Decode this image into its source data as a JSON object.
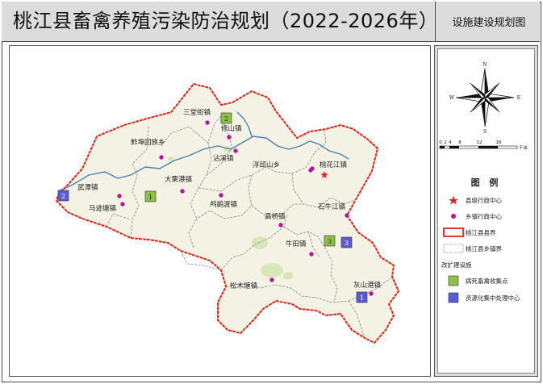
{
  "header": {
    "title": "桃江县畜禽养殖污染防治规划（2022-2026年）",
    "subtitle": "设施建设规划图"
  },
  "colors": {
    "county_border": "#e0261c",
    "township_border": "#8a8a8a",
    "land": "#f3f2e4",
    "forest": "#d8e7b8",
    "river": "#4a7fb5",
    "town_marker": "#b5169d",
    "county_center": "#e0261c",
    "collection_point": "#8fbe49",
    "resource_center": "#5b5bd6"
  },
  "map": {
    "towns": [
      {
        "name": "三堂街镇"
      },
      {
        "name": "修山镇"
      },
      {
        "name": "鲊埠回族乡"
      },
      {
        "name": "武潭镇"
      },
      {
        "name": "沾溪镇"
      },
      {
        "name": "浮邱山乡"
      },
      {
        "name": "桃花江镇"
      },
      {
        "name": "大栗港镇"
      },
      {
        "name": "马迹塘镇"
      },
      {
        "name": "鸬鹚渡镇"
      },
      {
        "name": "石牛江镇"
      },
      {
        "name": "高桥镇"
      },
      {
        "name": "牛田镇"
      },
      {
        "name": "松木塘镇"
      },
      {
        "name": "灰山港镇"
      }
    ],
    "facilities": [
      {
        "type": "collection_point",
        "number": "1"
      },
      {
        "type": "collection_point",
        "number": "2"
      },
      {
        "type": "collection_point",
        "number": "3"
      },
      {
        "type": "resource_center",
        "number": "1"
      },
      {
        "type": "resource_center",
        "number": "2"
      },
      {
        "type": "resource_center",
        "number": "3"
      }
    ]
  },
  "compass": {
    "n": "N",
    "s": "S",
    "e": "E",
    "w": "W"
  },
  "scale_bar": {
    "ticks": [
      "0",
      "2",
      "4",
      "8",
      "12",
      "16"
    ],
    "unit": "千米"
  },
  "legend": {
    "title": "图  例",
    "items": [
      {
        "symbol": "star",
        "label": "县级行政中心"
      },
      {
        "symbol": "dot",
        "label": "乡镇行政中心"
      },
      {
        "symbol": "county-line",
        "label": "桃江县县界"
      },
      {
        "symbol": "township-line",
        "label": "桃江县乡镇界"
      }
    ],
    "group_label": "改扩建设施",
    "facility_items": [
      {
        "symbol": "green-square",
        "label": "病死畜禽收集点"
      },
      {
        "symbol": "blue-square",
        "label": "资源化集中处理中心"
      }
    ]
  }
}
